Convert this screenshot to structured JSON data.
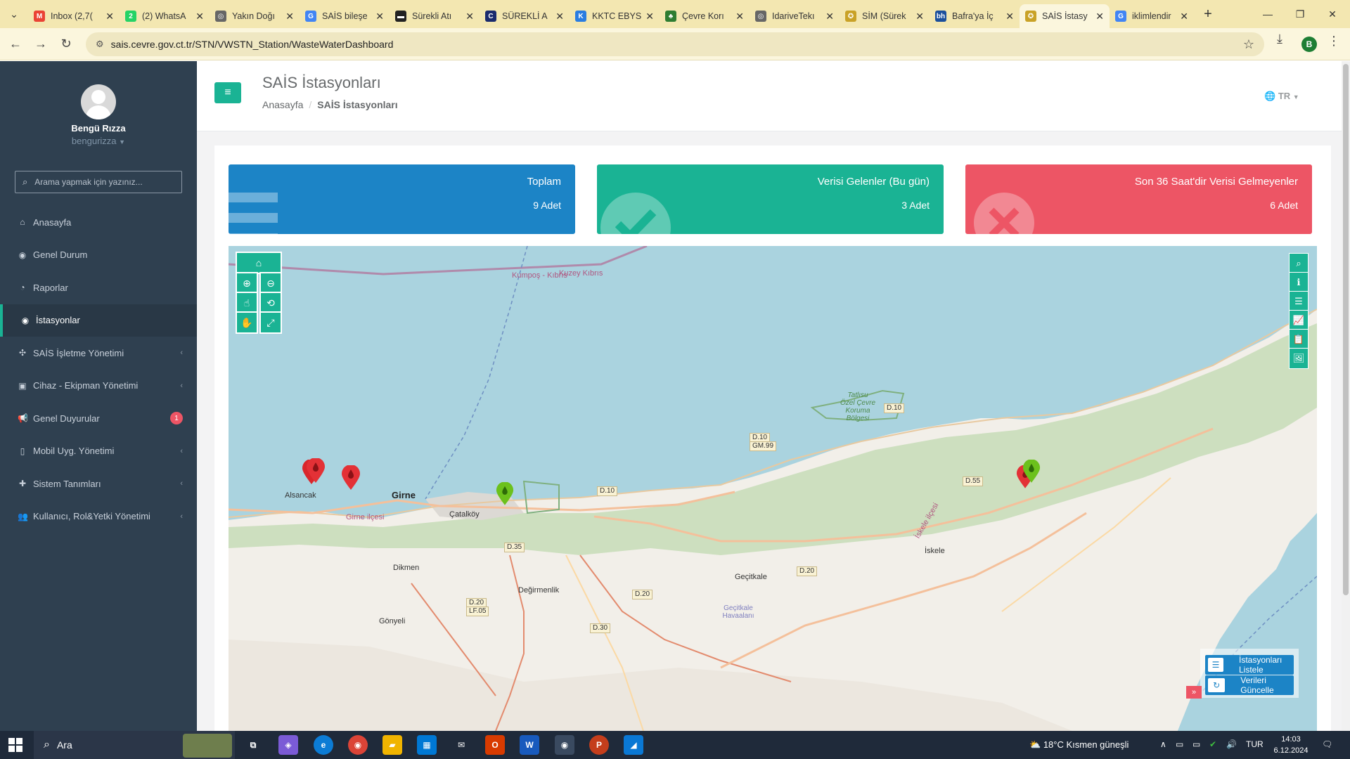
{
  "browser": {
    "tabs": [
      {
        "title": "Inbox (2,7(",
        "icon": "gmail-icon",
        "color": "#ea4335",
        "glyph": "M"
      },
      {
        "title": "(2) WhatsA",
        "icon": "whatsapp-icon",
        "color": "#25d366",
        "glyph": "2"
      },
      {
        "title": "Yakın Doğı",
        "icon": "globe-icon",
        "color": "#666666",
        "glyph": "◎"
      },
      {
        "title": "SAİS bileşe",
        "icon": "google-icon",
        "color": "#4285f4",
        "glyph": "G"
      },
      {
        "title": "Sürekli Atı",
        "icon": "site-icon",
        "color": "#222222",
        "glyph": "▬"
      },
      {
        "title": "SÜREKLİ A",
        "icon": "site-icon",
        "color": "#1a2b6d",
        "glyph": "C"
      },
      {
        "title": "KKTC EBYS",
        "icon": "ebys-icon",
        "color": "#2a7de1",
        "glyph": "K"
      },
      {
        "title": "Çevre Korı",
        "icon": "tree-icon",
        "color": "#2e7d32",
        "glyph": "♣"
      },
      {
        "title": "IdariveTekı",
        "icon": "globe-icon",
        "color": "#666666",
        "glyph": "◎"
      },
      {
        "title": "SİM (Sürek",
        "icon": "emblem-icon",
        "color": "#c9a227",
        "glyph": "✪"
      },
      {
        "title": "Bafra'ya İç",
        "icon": "bh-icon",
        "color": "#1b4f9c",
        "glyph": "bh"
      },
      {
        "title": "SAİS İstasy",
        "icon": "emblem-icon",
        "color": "#c9a227",
        "glyph": "✪",
        "active": true
      },
      {
        "title": "iklimlendir",
        "icon": "google-icon",
        "color": "#4285f4",
        "glyph": "G"
      }
    ],
    "new_tab": "+",
    "url": "sais.cevre.gov.ct.tr/STN/VWSTN_Station/WasteWaterDashboard",
    "profile_initial": "B"
  },
  "sidebar": {
    "user_name": "Bengü Rızza",
    "user_login": "bengurizza",
    "search_placeholder": "Arama yapmak için yazınız...",
    "items": [
      {
        "label": "Anasayfa",
        "icon": "home-icon",
        "glyph": "⌂",
        "name": "sidebar-item-anasayfa"
      },
      {
        "label": "Genel Durum",
        "icon": "dashboard-icon",
        "glyph": "◉",
        "name": "sidebar-item-genel-durum"
      },
      {
        "label": "Raporlar",
        "icon": "pie-chart-icon",
        "glyph": "◔",
        "name": "sidebar-item-raporlar"
      },
      {
        "label": "İstasyonlar",
        "icon": "eye-icon",
        "glyph": "◉",
        "name": "sidebar-item-istasyonlar",
        "active": true
      },
      {
        "label": "SAİS İşletme Yönetimi",
        "icon": "tools-icon",
        "glyph": "✣",
        "name": "sidebar-item-sais-isletme",
        "chevron": true
      },
      {
        "label": "Cihaz - Ekipman Yönetimi",
        "icon": "briefcase-icon",
        "glyph": "▣",
        "name": "sidebar-item-cihaz-ekipman",
        "chevron": true
      },
      {
        "label": "Genel Duyurular",
        "icon": "bullhorn-icon",
        "glyph": "📢",
        "name": "sidebar-item-genel-duyurular",
        "badge": "1"
      },
      {
        "label": "Mobil Uyg. Yönetimi",
        "icon": "mobile-icon",
        "glyph": "▯",
        "name": "sidebar-item-mobil-uyg",
        "chevron": true
      },
      {
        "label": "Sistem Tanımları",
        "icon": "plus-icon",
        "glyph": "✚",
        "name": "sidebar-item-sistem-tanimlari",
        "chevron": true
      },
      {
        "label": "Kullanıcı, Rol&Yetki Yönetimi",
        "icon": "users-icon",
        "glyph": "👥",
        "name": "sidebar-item-kullanici-rol",
        "chevron": true
      }
    ]
  },
  "header": {
    "title": "SAİS İstasyonları",
    "breadcrumb_home": "Anasayfa",
    "breadcrumb_current": "SAİS İstasyonları",
    "language": "TR"
  },
  "stats": [
    {
      "title": "Toplam",
      "value": "9 Adet",
      "color": "#1c84c6"
    },
    {
      "title": "Verisi Gelenler (Bu gün)",
      "value": "3 Adet",
      "color": "#1ab394"
    },
    {
      "title": "Son 36 Saat'dir Verisi Gelmeyenler",
      "value": "6 Adet",
      "color": "#ed5565"
    }
  ],
  "map": {
    "places": {
      "kumpos": "Kumpoş - Kıbrıs",
      "kuzey": "Kuzey Kıbrıs",
      "alsancak": "Alsancak",
      "girne": "Girne",
      "girne_ilcesi": "Girne ilçesi",
      "catalkoy": "Çatalköy",
      "dikmen": "Dikmen",
      "degirmenlik": "Değirmenlik",
      "gonyeli": "Gönyeli",
      "gecitkale": "Geçitkale",
      "gecitkale_airport": "Geçitkale Havaalanı",
      "iskele": "İskele",
      "iskele_ilcesi": "İskele ilçesi",
      "tatlisu": "Tatlısu Özel Çevre Koruma Bölgesi"
    },
    "roads": {
      "d10a": "D.10",
      "d10b": "D.10",
      "d10c": "D.10",
      "gm99": "GM.99",
      "d35": "D.35",
      "d20a": "D.20",
      "d20b": "D.20",
      "lf05": "LF.05",
      "d20c": "D.20",
      "d30": "D.30",
      "d55": "D.55"
    },
    "buttons": {
      "list": "İstasyonları Listele",
      "refresh": "Verileri Güncelle"
    }
  },
  "taskbar": {
    "search": "Ara",
    "weather": "18°C  Kısmen güneşli",
    "lang": "TUR",
    "time": "14:03",
    "date": "6.12.2024"
  }
}
